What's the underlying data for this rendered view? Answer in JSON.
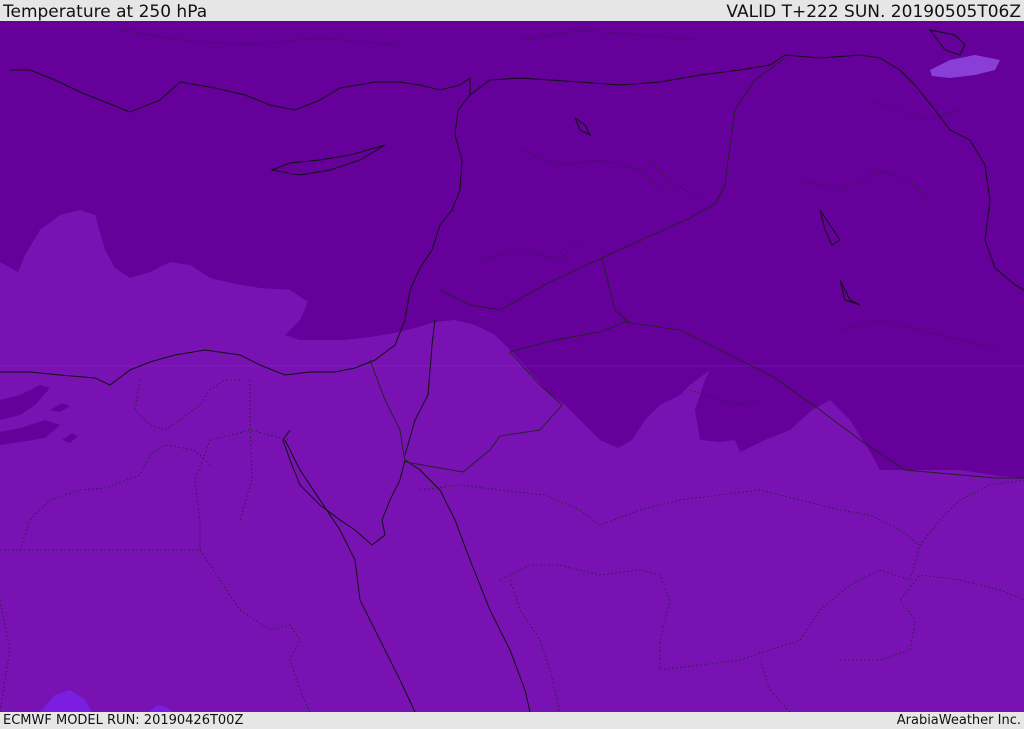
{
  "header": {
    "title": "Temperature at 250 hPa",
    "valid_time": "VALID T+222 SUN. 20190505T06Z"
  },
  "footer": {
    "model_run": "ECMWF MODEL RUN: 20190426T00Z",
    "credit": "ArabiaWeather Inc."
  },
  "map": {
    "field": "temperature at 250 hPa",
    "colors": {
      "colder_band": "#65009a",
      "warmer_band": "#7812b2",
      "warmest_patch": "#7b1ee0",
      "light_patch": "#8a3ed8",
      "coastline": "#111111",
      "border": "#222222"
    }
  }
}
